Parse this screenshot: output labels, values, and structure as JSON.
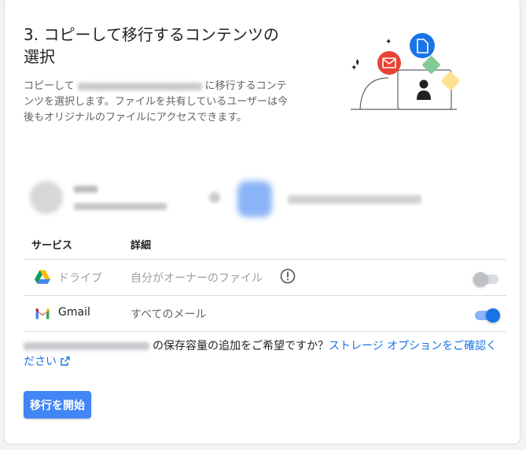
{
  "section": {
    "title": "3. コピーして移行するコンテンツの選択",
    "desc_before": "コピーして",
    "desc_after": "に移行するコンテンツを選択します。ファイルを共有しているユーザーは今後もオリジナルのファイルにアクセスできます。"
  },
  "table": {
    "col_service": "サービス",
    "col_detail": "詳細",
    "rows": [
      {
        "service": "ドライブ",
        "detail": "自分がオーナーのファイル",
        "icon": "google-drive-icon",
        "enabled": false
      },
      {
        "service": "Gmail",
        "detail": "すべてのメール",
        "icon": "gmail-icon",
        "enabled": true
      }
    ]
  },
  "storage": {
    "text": "の保存容量の追加をご希望ですか？",
    "link": "ストレージ オプションをご確認ください"
  },
  "start_button": "移行を開始",
  "colors": {
    "accent": "#1a73e8",
    "button": "#4285f4",
    "toggle_track_on": "#8ab4f8"
  }
}
